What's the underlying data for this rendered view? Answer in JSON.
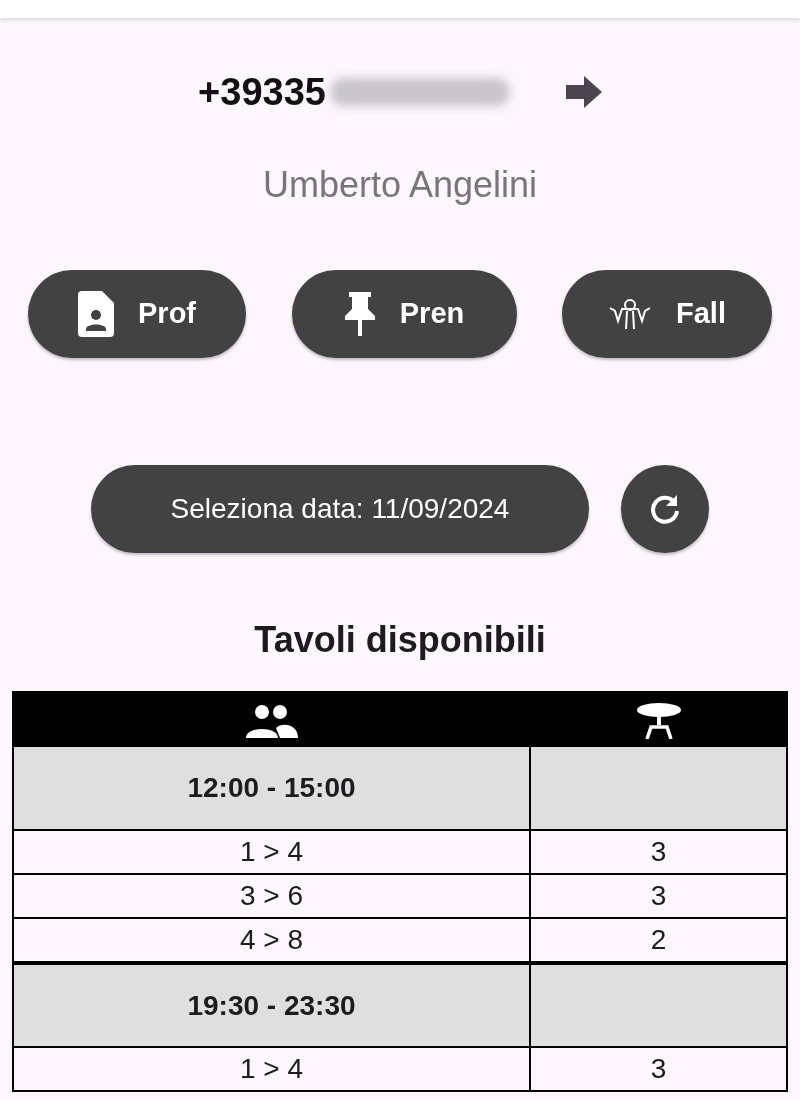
{
  "header": {
    "phone": "+39335",
    "name": "Umberto Angelini"
  },
  "actions": [
    {
      "label": "Prof",
      "kind": "profile"
    },
    {
      "label": "Pren",
      "kind": "pin"
    },
    {
      "label": "Fall",
      "kind": "figure"
    }
  ],
  "date_button": {
    "label": "Seleziona data: 11/09/2024"
  },
  "title": "Tavoli disponibili",
  "sections": [
    {
      "time": "12:00 - 15:00",
      "rows": [
        {
          "people": "1 > 4",
          "tables": "3"
        },
        {
          "people": "3 > 6",
          "tables": "3"
        },
        {
          "people": "4 > 8",
          "tables": "2"
        }
      ]
    },
    {
      "time": "19:30 - 23:30",
      "rows": [
        {
          "people": "1 > 4",
          "tables": "3"
        }
      ]
    }
  ]
}
